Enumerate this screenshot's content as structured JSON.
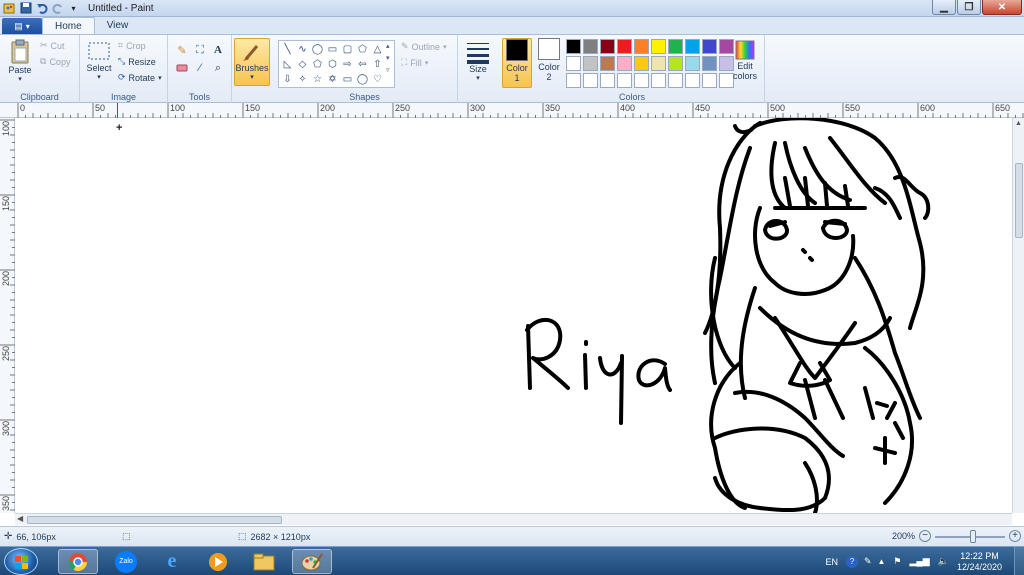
{
  "window": {
    "title": "Untitled - Paint",
    "buttons": [
      "minimize",
      "maximize",
      "close"
    ]
  },
  "tabs": [
    {
      "label": "Home",
      "active": true
    },
    {
      "label": "View",
      "active": false
    }
  ],
  "ribbon": {
    "clipboard": {
      "label": "Clipboard",
      "paste": "Paste",
      "cut": "Cut",
      "copy": "Copy"
    },
    "image": {
      "label": "Image",
      "select": "Select",
      "crop": "Crop",
      "resize": "Resize",
      "rotate": "Rotate"
    },
    "tools": {
      "label": "Tools"
    },
    "brushes": {
      "label": "Brushes"
    },
    "shapes": {
      "label": "Shapes",
      "outline": "Outline",
      "fill": "Fill"
    },
    "size": {
      "label": "Size"
    },
    "color1": {
      "label": "Color 1",
      "line1": "Color",
      "line2": "1",
      "color": "#000000"
    },
    "color2": {
      "label": "Color 2",
      "line1": "Color",
      "line2": "2",
      "color": "#ffffff"
    },
    "colors": {
      "label": "Colors"
    },
    "edit_colors": {
      "line1": "Edit",
      "line2": "colors"
    },
    "palette": [
      "#000000",
      "#7f7f7f",
      "#880015",
      "#ed1c24",
      "#ff7f27",
      "#fff200",
      "#22b14c",
      "#00a2e8",
      "#3f48cc",
      "#a349a4",
      "#ffffff",
      "#c3c3c3",
      "#b97a57",
      "#ffaec9",
      "#ffc90e",
      "#efe4b0",
      "#b5e61d",
      "#99d9ea",
      "#7092be",
      "#c8bfe7",
      "#ffffff",
      "#ffffff",
      "#ffffff",
      "#ffffff",
      "#ffffff",
      "#ffffff",
      "#ffffff",
      "#ffffff",
      "#ffffff",
      "#ffffff"
    ]
  },
  "ruler": {
    "h_labels": [
      "0",
      "50",
      "100",
      "150",
      "200",
      "250",
      "300",
      "350",
      "400",
      "450",
      "500",
      "550",
      "600",
      "650"
    ],
    "v_labels": [
      "100",
      "150",
      "200",
      "250",
      "300",
      "350"
    ]
  },
  "canvas": {
    "handwritten_text": "Riya"
  },
  "status": {
    "cursor_position": "66, 106px",
    "image_size": "2682 × 1210px",
    "zoom": "200%"
  },
  "taskbar": {
    "apps": [
      "chrome-icon",
      "zalo-icon",
      "internet-explorer-icon",
      "media-player-icon",
      "file-explorer-icon",
      "paint-icon"
    ],
    "zalo_label": "Zalo",
    "language": "EN",
    "time": "12:22 PM",
    "date": "12/24/2020"
  }
}
